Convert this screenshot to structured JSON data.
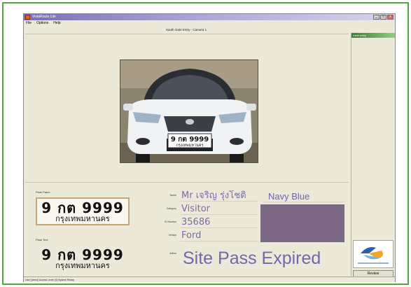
{
  "window": {
    "title": "VistaRoute Lite",
    "controls": [
      "_",
      "□",
      "x"
    ]
  },
  "menu": [
    "File",
    "Options",
    "Help"
  ],
  "camera": {
    "label": "South Gate Entry - Camera 1"
  },
  "right_panel": {
    "header": "Lane entry",
    "review_label": "Review"
  },
  "plate_patch": {
    "label": "Plate Patch",
    "number": "9 กต 9999",
    "province": "กรุงเทพมหานคร"
  },
  "plate_text": {
    "label": "Plate Text",
    "number": "9 กต 9999",
    "province": "กรุงเทพมหานคร"
  },
  "car_plate": {
    "number": "9 กต 9999",
    "province": "กรุงเทพมหานคร"
  },
  "fields": {
    "name": {
      "label": "Name",
      "value": "Mr เจริญ รุ่งโชติ"
    },
    "category": {
      "label": "Category",
      "value": "Visitor"
    },
    "id_number": {
      "label": "ID Number",
      "value": "35686"
    },
    "vehicle": {
      "label": "Vehicle",
      "value": "Ford"
    },
    "action": {
      "label": "Action",
      "value": "Site Pass Expired"
    }
  },
  "vehicle_color": {
    "name": "Navy Blue",
    "swatch": "#7b6884"
  },
  "statusbar": "User [demo]  Access Level: [0]  System Ready",
  "colors": {
    "frame": "#4ea83c",
    "window_bg": "#ece9d8",
    "value_text": "#7566ad"
  }
}
